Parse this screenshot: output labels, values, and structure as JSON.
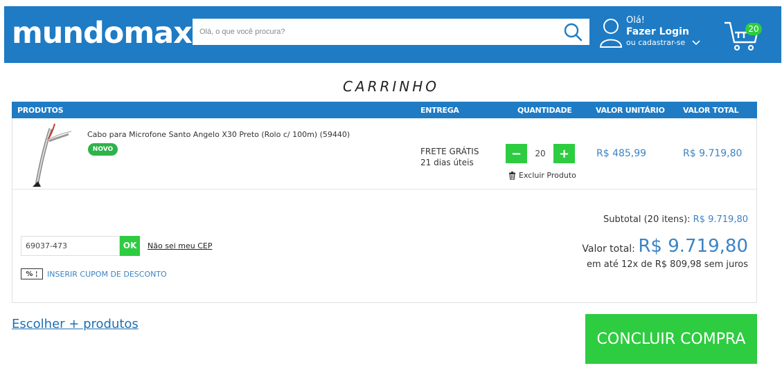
{
  "header": {
    "logo": "mundomax",
    "logo_mark": "®",
    "search_placeholder": "Olá, o que você procura?",
    "greeting": "Olá!",
    "login_label": "Fazer Login",
    "register_label": "ou cadastrar-se",
    "cart_count": "20",
    "colors": {
      "bar": "#1e7bc4",
      "badge": "#2ecc40"
    },
    "icons": [
      "search-icon",
      "user-icon",
      "chevron-down-icon",
      "cart-icon"
    ]
  },
  "page_title": "CARRINHO",
  "table": {
    "headers": {
      "produtos": "PRODUTOS",
      "entrega": "ENTREGA",
      "quantidade": "QUANTIDADE",
      "valor_unitario": "VALOR UNITÁRIO",
      "valor_total": "VALOR TOTAL"
    },
    "items": [
      {
        "name": "Cabo para Microfone Santo Angelo X30 Preto (Rolo c/ 100m) (59440)",
        "badge": "NOVO",
        "shipping_line1": "FRETE GRÁTIS",
        "shipping_line2": "21 dias úteis",
        "quantity": "20",
        "minus": "−",
        "plus": "+",
        "delete_label": "Excluir Produto",
        "unit_price": "R$ 485,99",
        "total_price": "R$ 9.719,80"
      }
    ]
  },
  "shipping_calc": {
    "cep_value": "69037-473",
    "ok_label": "OK",
    "unknown_cep_link": "Não sei meu CEP",
    "coupon_icon_text": "% ¦",
    "coupon_label": "INSERIR CUPOM DE DESCONTO"
  },
  "summary": {
    "subtotal_label": "Subtotal (20 itens):",
    "subtotal_value": "R$ 9.719,80",
    "total_label": "Valor total:",
    "total_value": "R$ 9.719,80",
    "installments": "em até 12x de R$ 809,98 sem juros"
  },
  "footer": {
    "more_products_link": "Escolher + produtos",
    "checkout_button": "CONCLUIR COMPRA"
  }
}
